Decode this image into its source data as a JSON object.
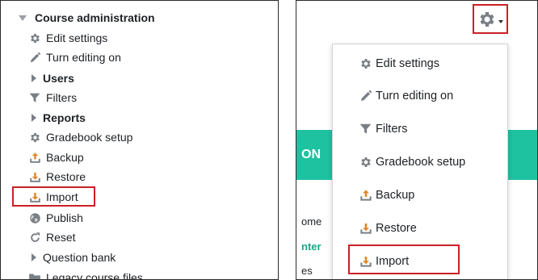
{
  "left": {
    "header": "Course administration",
    "items": [
      {
        "label": "Edit settings",
        "icon": "gear-icon"
      },
      {
        "label": "Turn editing on",
        "icon": "pencil-icon"
      },
      {
        "label": "Users",
        "icon": "caret-right-icon"
      },
      {
        "label": "Filters",
        "icon": "filter-icon"
      },
      {
        "label": "Reports",
        "icon": "caret-right-icon"
      },
      {
        "label": "Gradebook setup",
        "icon": "gear-icon"
      },
      {
        "label": "Backup",
        "icon": "upload-tray-icon"
      },
      {
        "label": "Restore",
        "icon": "download-tray-icon"
      },
      {
        "label": "Import",
        "icon": "download-tray-icon"
      },
      {
        "label": "Publish",
        "icon": "globe-icon"
      },
      {
        "label": "Reset",
        "icon": "reset-icon"
      },
      {
        "label": "Question bank",
        "icon": "caret-right-icon"
      },
      {
        "label": "Legacy course files",
        "icon": "folder-icon"
      }
    ]
  },
  "right": {
    "banner_text": "ON",
    "bg_lines": [
      "ome",
      "nter",
      "es"
    ],
    "menu": [
      {
        "label": "Edit settings",
        "icon": "gear-icon"
      },
      {
        "label": "Turn editing on",
        "icon": "pencil-icon"
      },
      {
        "label": "Filters",
        "icon": "filter-icon"
      },
      {
        "label": "Gradebook setup",
        "icon": "gear-icon"
      },
      {
        "label": "Backup",
        "icon": "upload-tray-icon"
      },
      {
        "label": "Restore",
        "icon": "download-tray-icon"
      },
      {
        "label": "Import",
        "icon": "download-tray-icon"
      }
    ]
  },
  "colors": {
    "highlight": "#cc1f26",
    "icon_gray": "#7a7f85",
    "accent_teal": "#1ec2a1",
    "import_icon": "#e0892a"
  }
}
